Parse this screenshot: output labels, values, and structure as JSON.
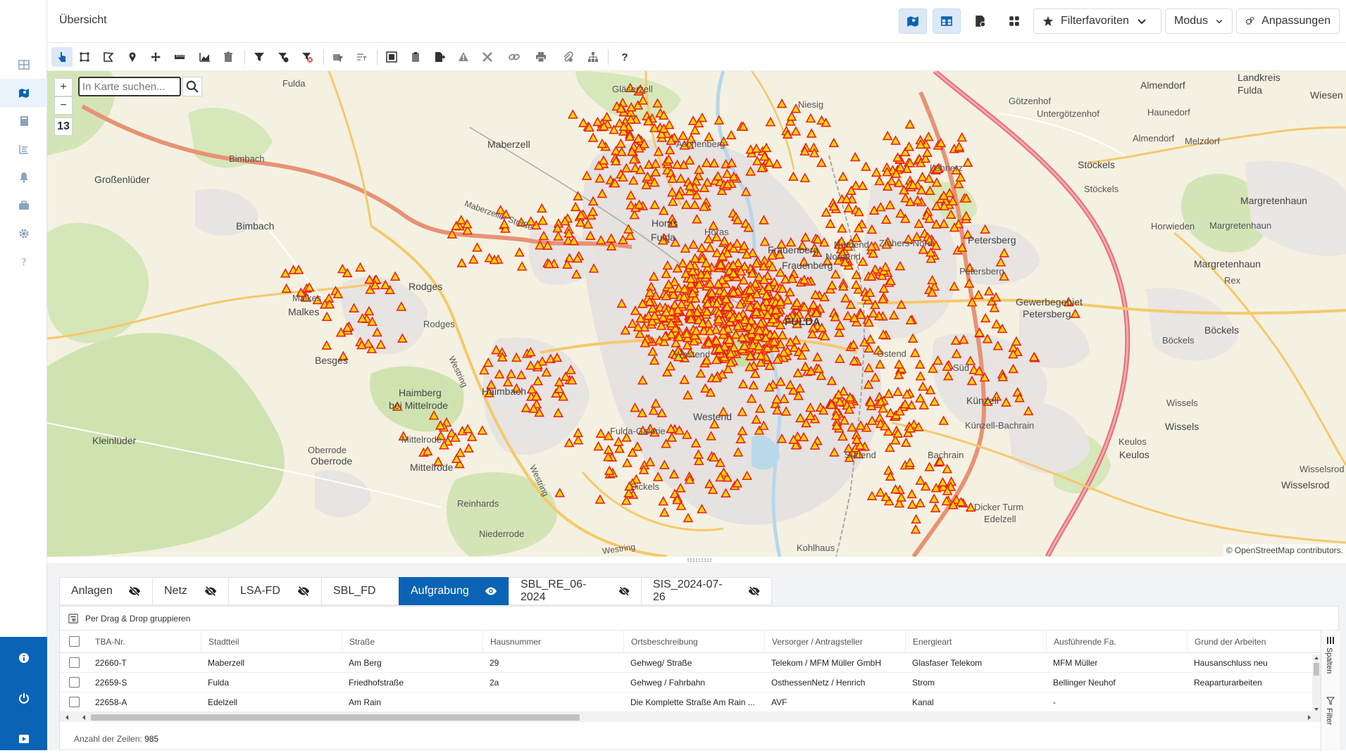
{
  "header": {
    "title": "Übersicht",
    "filter_favorites_label": "Filterfavoriten",
    "mode_label": "Modus",
    "customize_label": "Anpassungen"
  },
  "map": {
    "search_placeholder": "In Karte suchen...",
    "zoom_in": "+",
    "zoom_out": "−",
    "zoom_level": "13",
    "attribution": "© OpenStreetMap contributors.",
    "labels": {
      "fulda_top": "Fulda",
      "bimbach1": "Bimbach",
      "grossenluder": "Großenlüder",
      "bimbach2": "Bimbach",
      "maberzell1": "Maberzell",
      "maberzeller_strasse": "Maberzeller Straße",
      "rodges1": "Rodges",
      "rodges2": "Rodges",
      "malkes1": "Malkes",
      "malkes2": "Malkes",
      "besges": "Besges",
      "haimberg": "Haimberg",
      "bei_mittelrode": "bei Mittelrode",
      "haimbach": "Haimbach",
      "kleinluder": "Kleinlüder",
      "oberrode1": "Oberrode",
      "oberrode2": "Oberrode",
      "mittelrode1": "Mittelrode",
      "mittelrode2": "Mittelrode",
      "westring1": "Westring",
      "westring2": "Westring",
      "westring3": "Westring",
      "reinhards": "Reinhards",
      "niederrode": "Niederrode",
      "glaszell": "Gläserzell",
      "aschenberg": "Aschenberg",
      "horas1": "Horas",
      "horas2": "Horas",
      "fulda2": "Fulda",
      "frauenberg": "Frauenberg",
      "fulda_city": "FULDA",
      "westend1": "Westend",
      "westend2": "Westend",
      "fulda_galerie": "Fulda-Galerie",
      "sickels": "Sickels",
      "nordend1": "Nordend",
      "nordend2": "Nordend",
      "ostend": "Ostend",
      "suedend": "Südend",
      "kohlhaus": "Kohlhaus",
      "niesig": "Niesig",
      "lehnerz": "Lehnerz",
      "ziehers_nord": "Ziehers-Nord",
      "petersberg1": "Petersberg",
      "petersberg2": "Petersberg",
      "gewerbegebiet": "Gewerbegebiet",
      "petersberg3": "Petersberg",
      "kuenzell1": "Künzell",
      "kuenzell_bachrain": "Künzell-Bachrain",
      "bachrain": "Bachrain",
      "dicker_turm": "Dicker Turm",
      "goetzenhof": "Götzenhof",
      "untergoetzenhof": "Untergötzenhof",
      "haunedorf": "Haunedorf",
      "almendorf1": "Almendorf",
      "almendorf2": "Almendorf",
      "melzdorf": "Melzdorf",
      "landkreis_fulda": "Landkreis\nFulda",
      "wiesen": "Wiesen",
      "stoeckels1": "Stöckels",
      "stoeckels2": "Stöckels",
      "margretenhaun1": "Margretenhaun",
      "margretenhaun2": "Margretenhaun",
      "margretenhaun3": "Margretenhaun",
      "horwieden": "Horwieden",
      "rex": "Rex",
      "boeckels1": "Böckels",
      "boeckels2": "Böckels",
      "wissels1": "Wissels",
      "wissels2": "Wissels",
      "keulos1": "Keulos",
      "keulos2": "Keulos",
      "wisselsrod1": "Wisselsrod",
      "wisselsrod2": "Wisselsrod",
      "sued": "Süd",
      "edelzell": "Edelzell"
    }
  },
  "tabs": [
    {
      "label": "Anlagen",
      "visible": false
    },
    {
      "label": "Netz",
      "visible": false
    },
    {
      "label": "LSA-FD",
      "visible": false
    },
    {
      "label": "SBL_FD",
      "visible": false
    },
    {
      "label": "Aufgrabung",
      "visible": true
    },
    {
      "label": "SBL_RE_06-2024",
      "visible": false
    },
    {
      "label": "SIS_2024-07-26",
      "visible": false
    }
  ],
  "grid": {
    "group_hint": "Per Drag & Drop gruppieren",
    "columns": [
      "TBA-Nr.",
      "Stadtteil",
      "Straße",
      "Hausnummer",
      "Ortsbeschreibung",
      "Versorger / Antragsteller",
      "Energieart",
      "Ausführende Fa.",
      "Grund der Arbeiten"
    ],
    "rows": [
      [
        "22660-T",
        "Maberzell",
        "Am Berg",
        "29",
        "Gehweg/ Straße",
        "Telekom / MFM Müller GmbH",
        "Glasfaser Telekom",
        "MFM Müller",
        "Hausanschluss neu"
      ],
      [
        "22659-S",
        "Fulda",
        "Friedhofstraße",
        "2a",
        "Gehweg / Fahrbahn",
        "OsthessenNetz / Henrich",
        "Strom",
        "Bellinger Neuhof",
        "Reaparturarbeiten"
      ],
      [
        "22658-A",
        "Edelzell",
        "Am Rain",
        "",
        "Die Komplette Straße Am Rain ...",
        "AVF",
        "Kanal",
        "-",
        ""
      ]
    ],
    "side_columns_label": "Spalten",
    "side_filter_label": "Filter",
    "row_count_label": "Anzahl der Zeilen:",
    "row_count": "985"
  },
  "colors": {
    "accent": "#0a63b4",
    "marker_fill": "#ffd400",
    "marker_stroke": "#e8231b",
    "highway": "#e8707a",
    "main_road": "#f5c96b"
  }
}
